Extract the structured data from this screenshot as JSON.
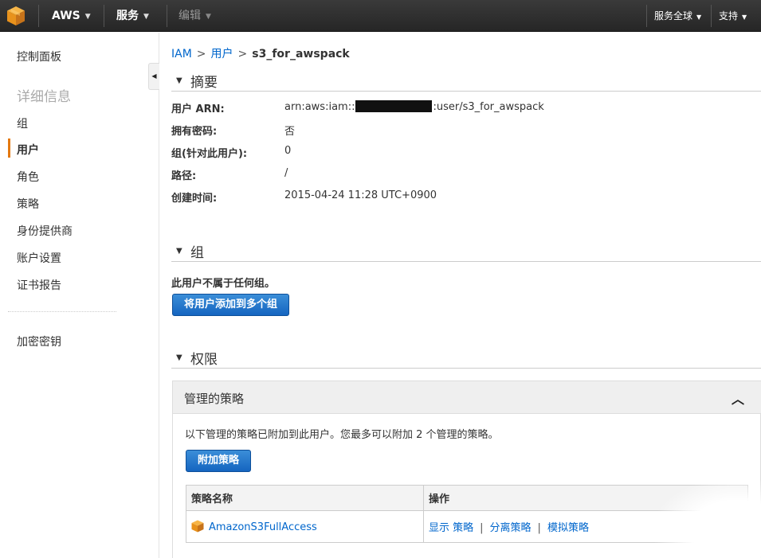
{
  "topbar": {
    "brand": "AWS",
    "services": "服务",
    "edit": "编辑",
    "region": "服务全球",
    "support": "支持",
    "logo_icon": "aws-cube-icon",
    "caret_icon": "chevron-down-icon"
  },
  "sidebar": {
    "dashboard": "控制面板",
    "details_heading": "详细信息",
    "items": [
      {
        "label": "组"
      },
      {
        "label": "用户",
        "active": true
      },
      {
        "label": "角色"
      },
      {
        "label": "策略"
      },
      {
        "label": "身份提供商"
      },
      {
        "label": "账户设置"
      },
      {
        "label": "证书报告"
      }
    ],
    "encryption_keys": "加密密钥",
    "accent_color": "#e47911"
  },
  "breadcrumb": {
    "root": "IAM",
    "users": "用户",
    "current": "s3_for_awspack",
    "separator": ">"
  },
  "summary": {
    "title": "摘要",
    "rows": [
      {
        "label": "用户 ARN:",
        "value_prefix": "arn:aws:iam::",
        "value_suffix": ":user/s3_for_awspack"
      },
      {
        "label": "拥有密码:",
        "value": "否"
      },
      {
        "label": "组(针对此用户):",
        "value": "0"
      },
      {
        "label": "路径:",
        "value": "/"
      },
      {
        "label": "创建时间:",
        "value": "2015-04-24 11:28 UTC+0900"
      }
    ]
  },
  "groups": {
    "title": "组",
    "message": "此用户不属于任何组。",
    "add_button": "将用户添加到多个组"
  },
  "permissions": {
    "title": "权限",
    "managed_title": "管理的策略",
    "description": "以下管理的策略已附加到此用户。您最多可以附加 2 个管理的策略。",
    "attach_button": "附加策略",
    "table": {
      "columns": [
        "策略名称",
        "操作"
      ],
      "rows": [
        {
          "name": "AmazonS3FullAccess",
          "actions": [
            "显示 策略",
            "分离策略",
            "模拟策略"
          ],
          "separator": "|"
        }
      ]
    }
  },
  "colors": {
    "link": "#0066cc",
    "button": "#1a6ec8",
    "topbar": "#2b2b2b"
  }
}
